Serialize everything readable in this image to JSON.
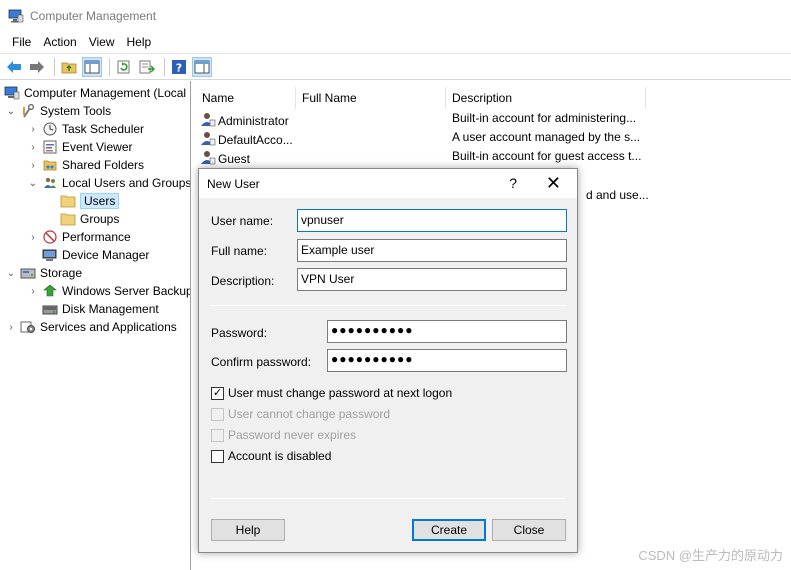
{
  "window": {
    "title": "Computer Management"
  },
  "menu": [
    "File",
    "Action",
    "View",
    "Help"
  ],
  "toolbar": {
    "buttons": [
      "back-icon",
      "forward-icon",
      "up-folder-icon",
      "show-hide-tree-icon",
      "refresh-icon",
      "export-list-icon",
      "help-icon",
      "show-action-pane-icon"
    ]
  },
  "tree": {
    "root": "Computer Management (Local",
    "system_tools": "System Tools",
    "task_scheduler": "Task Scheduler",
    "event_viewer": "Event Viewer",
    "shared_folders": "Shared Folders",
    "local_users_groups": "Local Users and Groups",
    "users": "Users",
    "groups": "Groups",
    "performance": "Performance",
    "device_manager": "Device Manager",
    "storage": "Storage",
    "windows_server_backup": "Windows Server Backup",
    "disk_management": "Disk Management",
    "services_apps": "Services and Applications"
  },
  "list": {
    "columns": [
      "Name",
      "Full Name",
      "Description"
    ],
    "rows": [
      {
        "name": "Administrator",
        "full_name": "",
        "description": "Built-in account for administering..."
      },
      {
        "name": "DefaultAcco...",
        "full_name": "",
        "description": "A user account managed by the s..."
      },
      {
        "name": "Guest",
        "full_name": "",
        "description": "Built-in account for guest access t..."
      }
    ],
    "partial_text": "d and use..."
  },
  "dialog": {
    "title": "New User",
    "help_glyph": "?",
    "close_glyph": "✕",
    "username_label": "User name:",
    "username_value": "vpnuser",
    "fullname_label": "Full name:",
    "fullname_value": "Example user",
    "description_label": "Description:",
    "description_value": "VPN User",
    "password_label": "Password:",
    "password_value": "●●●●●●●●●●",
    "confirm_label": "Confirm password:",
    "confirm_value": "●●●●●●●●●●",
    "options": {
      "must_change": {
        "label": "User must change password at next logon",
        "checked": true,
        "enabled": true
      },
      "cannot_change": {
        "label": "User cannot change password",
        "checked": false,
        "enabled": false
      },
      "never_expires": {
        "label": "Password never expires",
        "checked": false,
        "enabled": false
      },
      "disabled": {
        "label": "Account is disabled",
        "checked": false,
        "enabled": true
      }
    },
    "help_button": "Help",
    "create_button": "Create",
    "close_button": "Close"
  },
  "watermark": "CSDN @生产力的原动力",
  "colors": {
    "accent": "#0078d7",
    "selection": "#cce8ff"
  }
}
